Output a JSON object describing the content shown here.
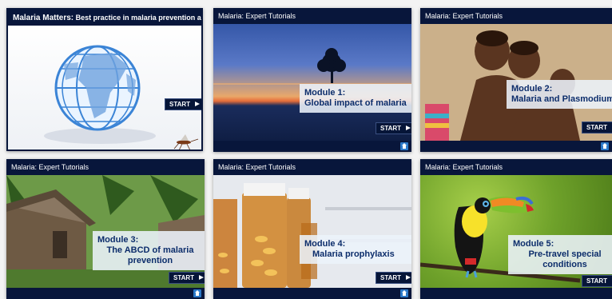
{
  "cards": [
    {
      "header_brand": "Malaria Matters:",
      "header_subtitle": "Best practice in malaria prevention advice",
      "start_label": "START"
    },
    {
      "header": "Malaria: Expert Tutorials",
      "module_number": "Module 1:",
      "module_title": "Global impact of malaria",
      "start_label": "START"
    },
    {
      "header": "Malaria: Expert Tutorials",
      "module_number": "Module 2:",
      "module_title": "Malaria and Plasmodium",
      "start_label": "START"
    },
    {
      "header": "Malaria: Expert Tutorials",
      "module_number": "Module 3:",
      "module_title": "The ABCD of malaria prevention",
      "start_label": "START"
    },
    {
      "header": "Malaria: Expert Tutorials",
      "module_number": "Module 4:",
      "module_title": "Malaria prophylaxis",
      "start_label": "START"
    },
    {
      "header": "Malaria: Expert Tutorials",
      "module_number": "Module 5:",
      "module_title": "Pre-travel special conditions",
      "start_label": "START"
    }
  ],
  "icons": [
    "globe-icon",
    "mosquito-icon",
    "home-icon",
    "play-arrow-icon"
  ],
  "colors": {
    "header_bg": "#08163b",
    "title_text": "#0c2d6b",
    "title_box": "#ecf2fa"
  }
}
